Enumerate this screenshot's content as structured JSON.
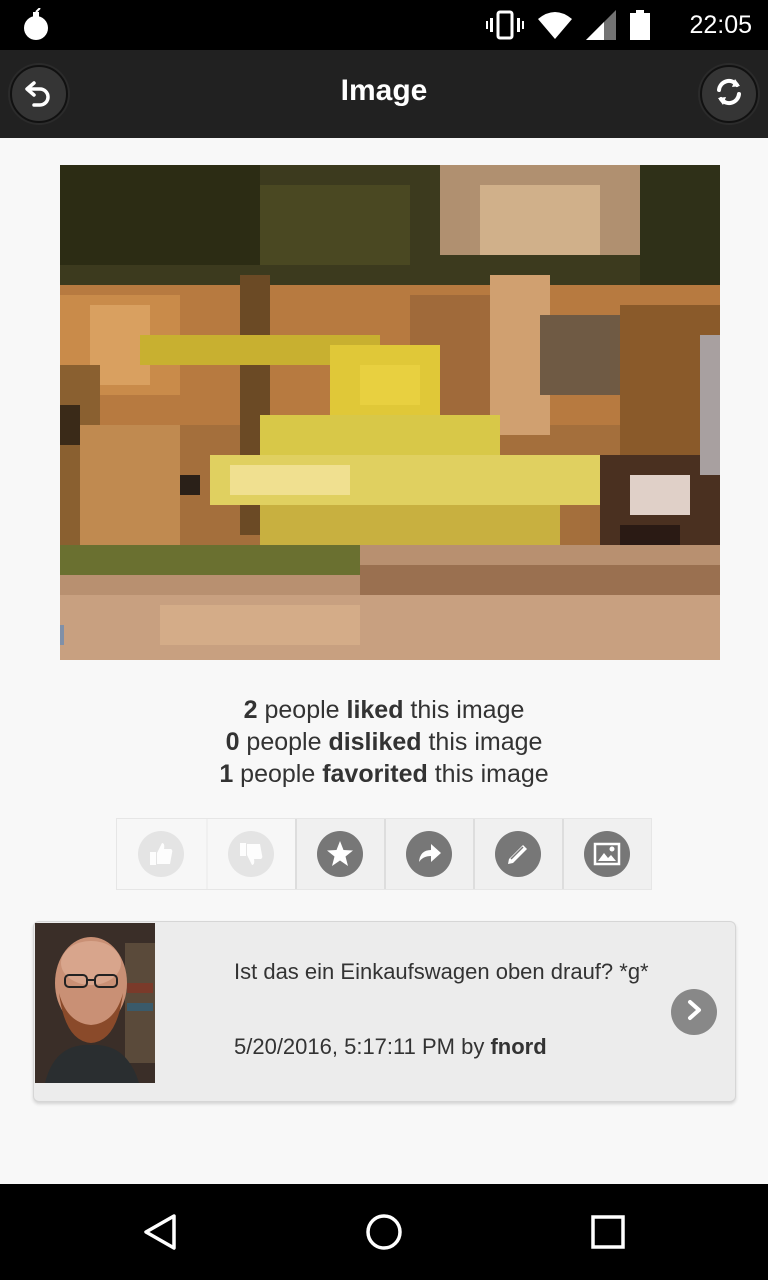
{
  "status_bar": {
    "time": "22:05",
    "icons": [
      "app-bomb-icon",
      "vibrate-icon",
      "wifi-icon",
      "signal-icon",
      "battery-icon"
    ]
  },
  "header": {
    "title": "Image",
    "back_icon": "undo-icon",
    "refresh_icon": "refresh-icon",
    "background": "#212121"
  },
  "stats": {
    "liked_count": "2",
    "liked_pre": " people ",
    "liked_word": "liked",
    "liked_post": " this image",
    "disliked_count": "0",
    "disliked_pre": " people ",
    "disliked_word": "disliked",
    "disliked_post": " this image",
    "favorited_count": "1",
    "favorited_pre": " people ",
    "favorited_word": "favorited",
    "favorited_post": " this image"
  },
  "actions": [
    {
      "icon": "thumbs-up-icon",
      "enabled": false
    },
    {
      "icon": "thumbs-down-icon",
      "enabled": false
    },
    {
      "icon": "star-icon",
      "enabled": true
    },
    {
      "icon": "share-icon",
      "enabled": true
    },
    {
      "icon": "pencil-icon",
      "enabled": true
    },
    {
      "icon": "image-icon",
      "enabled": true
    }
  ],
  "comment": {
    "text": "Ist das ein Einkaufswagen oben drauf? *g*",
    "timestamp": "5/20/2016, 5:17:11 PM",
    "by": " by ",
    "author": "fnord",
    "chevron_icon": "chevron-right-icon"
  },
  "nav_bar": {
    "icons": [
      "nav-back-icon",
      "nav-home-icon",
      "nav-recents-icon"
    ]
  }
}
